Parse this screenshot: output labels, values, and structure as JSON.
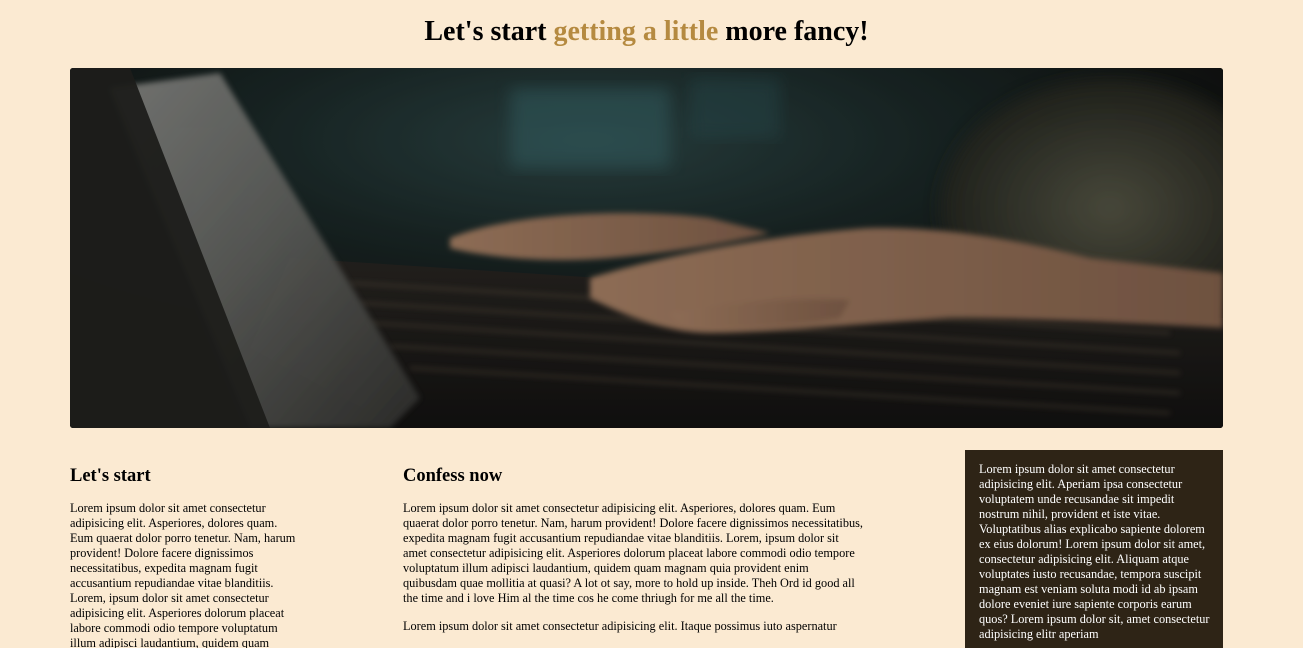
{
  "header": {
    "title_part1": "Let's start ",
    "title_accent": "getting a little",
    "title_part2": " more fancy!"
  },
  "hero": {
    "image_icon": "laptop-typing-photo"
  },
  "left_column": {
    "heading": "Let's start",
    "paragraph": "Lorem ipsum dolor sit amet consectetur adipisicing elit. Asperiores, dolores quam. Eum quaerat dolor porro tenetur. Nam, harum provident! Dolore facere dignissimos necessitatibus, expedita magnam fugit accusantium repudiandae vitae blanditiis. Lorem, ipsum dolor sit amet consectetur adipisicing elit. Asperiores dolorum placeat labore commodi odio tempore voluptatum illum adipisci laudantium, quidem quam"
  },
  "middle_column": {
    "heading": "Confess now",
    "paragraph1": "Lorem ipsum dolor sit amet consectetur adipisicing elit. Asperiores, dolores quam. Eum quaerat dolor porro tenetur. Nam, harum provident! Dolore facere dignissimos necessitatibus, expedita magnam fugit accusantium repudiandae vitae blanditiis. Lorem, ipsum dolor sit amet consectetur adipisicing elit. Asperiores dolorum placeat labore commodi odio tempore voluptatum illum adipisci laudantium, quidem quam magnam quia provident enim quibusdam quae mollitia at quasi? A lot ot say, more to hold up inside. Theh Ord id good all the time and i love Him al the time cos he come thriugh for me all the time.",
    "paragraph2": "Lorem ipsum dolor sit amet consectetur adipisicing elit. Itaque possimus iuto aspernatur"
  },
  "aside": {
    "paragraph": "Lorem ipsum dolor sit amet consectetur adipisicing elit. Aperiam ipsa consectetur voluptatem unde recusandae sit impedit nostrum nihil, provident et iste vitae. Voluptatibus alias explicabo sapiente dolorem ex eius dolorum! Lorem ipsum dolor sit amet, consectetur adipisicing elit. Aliquam atque voluptates iusto recusandae, tempora suscipit magnam est veniam soluta modi id ab ipsam dolore eveniet iure sapiente corporis earum quos? Lorem ipsum dolor sit, amet consectetur adipisicing elitr aperiam",
    "background": "#2e2416"
  },
  "colors": {
    "page_background": "#fbead2",
    "accent": "#b58a40"
  }
}
